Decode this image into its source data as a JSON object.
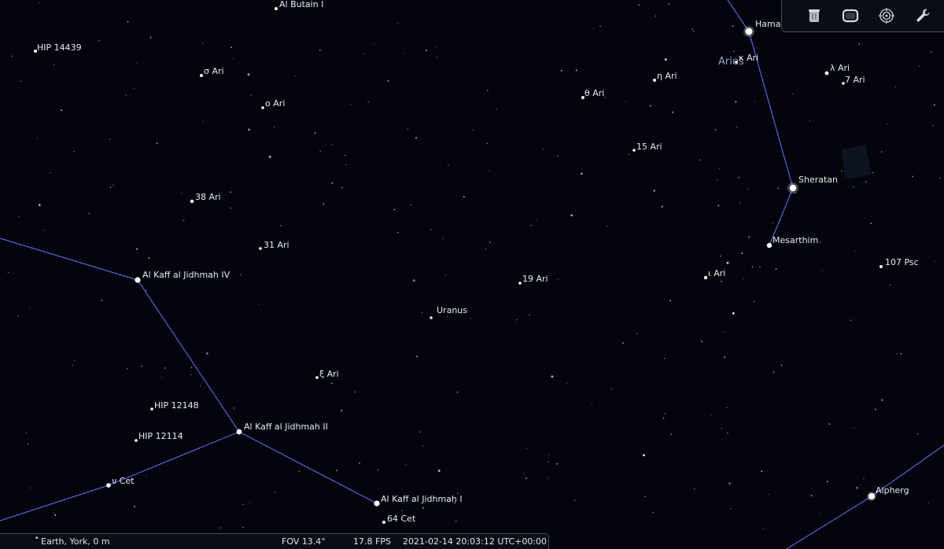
{
  "constellation": {
    "name": "Aries",
    "line_color": "#5b63d8"
  },
  "objects": [
    {
      "id": "al-butain-i",
      "label": "Al Butain I"
    },
    {
      "id": "hip-14439",
      "label": "HIP 14439"
    },
    {
      "id": "sigma-ari",
      "label": "σ Ari"
    },
    {
      "id": "omicron-ari",
      "label": "ο Ari"
    },
    {
      "id": "38-ari",
      "label": "38 Ari"
    },
    {
      "id": "31-ari",
      "label": "31 Ari"
    },
    {
      "id": "al-kaff-iv",
      "label": "Al Kaff al Jidhmah IV"
    },
    {
      "id": "xi-ari",
      "label": "ξ Ari"
    },
    {
      "id": "hip-12148",
      "label": "HIP 12148"
    },
    {
      "id": "hip-12114",
      "label": "HIP 12114"
    },
    {
      "id": "al-kaff-ii",
      "label": "Al Kaff al Jidhmah II"
    },
    {
      "id": "nu-cet",
      "label": "ν Cet"
    },
    {
      "id": "al-kaff-i",
      "label": "Al Kaff al Jidhmah I"
    },
    {
      "id": "64-cet",
      "label": "64 Cet"
    },
    {
      "id": "uranus",
      "label": "Uranus"
    },
    {
      "id": "19-ari",
      "label": "19 Ari"
    },
    {
      "id": "theta-ari",
      "label": "θ Ari"
    },
    {
      "id": "eta-ari",
      "label": "η Ari"
    },
    {
      "id": "15-ari",
      "label": "15 Ari"
    },
    {
      "id": "hamal",
      "label": "Hamal"
    },
    {
      "id": "kappa-ari",
      "label": "κ Ari"
    },
    {
      "id": "lambda-ari",
      "label": "λ Ari"
    },
    {
      "id": "7-ari",
      "label": "7 Ari"
    },
    {
      "id": "sheratan",
      "label": "Sheratan"
    },
    {
      "id": "mesarthim",
      "label": "Mesarthim"
    },
    {
      "id": "iota-ari",
      "label": "ι Ari"
    },
    {
      "id": "107-psc",
      "label": "107 Psc"
    },
    {
      "id": "alpherg",
      "label": "Alpherg"
    }
  ],
  "toolbar": {
    "buttons": [
      {
        "icon": "trash-icon",
        "title": "Delete"
      },
      {
        "icon": "screen-icon",
        "title": "Full screen"
      },
      {
        "icon": "target-icon",
        "title": "Center on selected object"
      },
      {
        "icon": "wrench-icon",
        "title": "Settings"
      }
    ]
  },
  "status": {
    "location": "Earth, York, 0 m",
    "fov": "FOV 13.4°",
    "fps": "17.8 FPS",
    "datetime": "2021-02-14 20:03:12 UTC+00:00"
  }
}
